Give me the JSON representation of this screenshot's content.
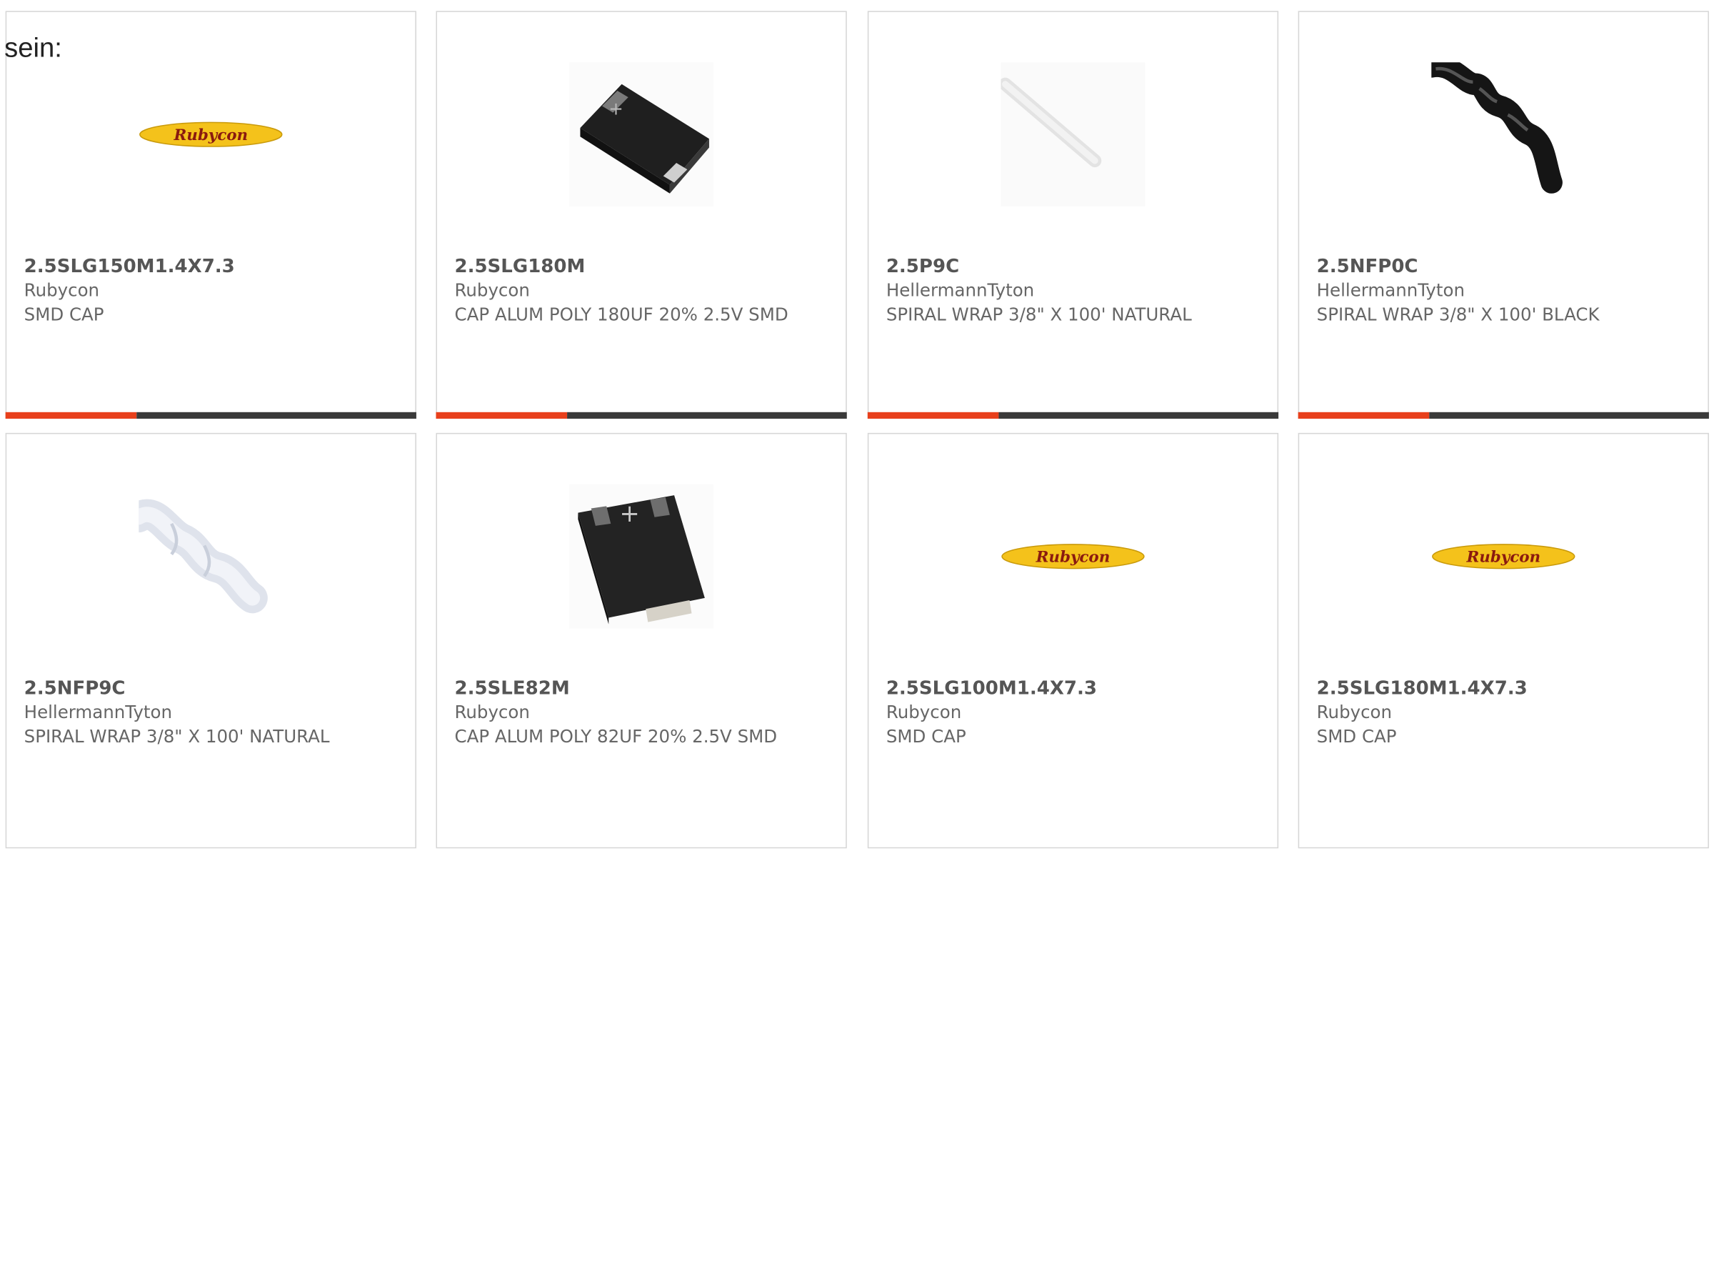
{
  "intro_text": "sein:",
  "colors": {
    "accent": "#e8401c",
    "bar_dark": "#3a3a3a",
    "logo_yellow": "#f4c21b",
    "logo_text": "#8a1a0f"
  },
  "products": [
    {
      "part": "2.5SLG150M1.4X7.3",
      "maker": "Rubycon",
      "desc": "SMD CAP",
      "image": "rubycon-logo"
    },
    {
      "part": "2.5SLG180M",
      "maker": "Rubycon",
      "desc": "CAP ALUM POLY 180UF 20% 2.5V SMD",
      "image": "smd-capacitor"
    },
    {
      "part": "2.5P9C",
      "maker": "HellermannTyton",
      "desc": "SPIRAL WRAP 3/8\" X 100' NATURAL",
      "image": "spiral-wrap-natural"
    },
    {
      "part": "2.5NFP0C",
      "maker": "HellermannTyton",
      "desc": "SPIRAL WRAP 3/8\" X 100' BLACK",
      "image": "spiral-wrap-black"
    },
    {
      "part": "2.5NFP9C",
      "maker": "HellermannTyton",
      "desc": "SPIRAL WRAP 3/8\" X 100' NATURAL",
      "image": "spiral-wrap-natural"
    },
    {
      "part": "2.5SLE82M",
      "maker": "Rubycon",
      "desc": "CAP ALUM POLY 82UF 20% 2.5V SMD",
      "image": "smd-capacitor"
    },
    {
      "part": "2.5SLG100M1.4X7.3",
      "maker": "Rubycon",
      "desc": "SMD CAP",
      "image": "rubycon-logo"
    },
    {
      "part": "2.5SLG180M1.4X7.3",
      "maker": "Rubycon",
      "desc": "SMD CAP",
      "image": "rubycon-logo"
    }
  ],
  "logo_word": "Rubycon"
}
